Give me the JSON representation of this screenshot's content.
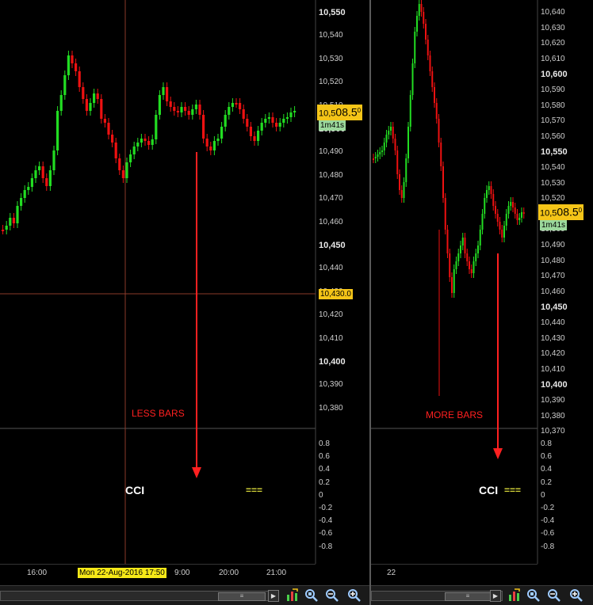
{
  "left_chart": {
    "price_ticks": [
      "10,550",
      "10,540",
      "10,530",
      "10,520",
      "10,510",
      "10,500",
      "10,490",
      "10,480",
      "10,470",
      "10,460",
      "10,450",
      "10,440",
      "10,430",
      "10,420",
      "10,410",
      "10,400",
      "10,390",
      "10,380"
    ],
    "bold_ticks": [
      "10,550",
      "10,500",
      "10,450",
      "10,400"
    ],
    "price_tag_prefix": "10,5",
    "price_tag_main": "08.5",
    "price_tag_sup": "0",
    "timer": "1m41s",
    "crosshair_price": "10,430.0",
    "annotation": "LESS BARS",
    "indicator_label": "CCI",
    "indicator_eq": "===",
    "cci_ticks": [
      "0.8",
      "0.6",
      "0.4",
      "0.2",
      "0",
      "-0.2",
      "-0.4",
      "-0.6",
      "-0.8"
    ],
    "time_labels": [
      "16:00",
      "9:00",
      "20:00",
      "21:00"
    ],
    "date_tag": "Mon 22-Aug-2016 17:50"
  },
  "right_chart": {
    "price_ticks": [
      "10,640",
      "10,630",
      "10,620",
      "10,610",
      "10,600",
      "10,590",
      "10,580",
      "10,570",
      "10,560",
      "10,550",
      "10,540",
      "10,530",
      "10,520",
      "10,510",
      "10,500",
      "10,490",
      "10,480",
      "10,470",
      "10,460",
      "10,450",
      "10,440",
      "10,430",
      "10,420",
      "10,410",
      "10,400",
      "10,390",
      "10,380",
      "10,370"
    ],
    "bold_ticks": [
      "10,600",
      "10,550",
      "10,450",
      "10,400"
    ],
    "price_tag_prefix": "10,5",
    "price_tag_main": "08.5",
    "price_tag_sup": "0",
    "timer": "1m41s",
    "annotation": "MORE BARS",
    "indicator_label": "CCI",
    "indicator_eq": "===",
    "cci_ticks": [
      "0.8",
      "0.6",
      "0.4",
      "0.2",
      "0",
      "-0.2",
      "-0.4",
      "-0.6",
      "-0.8"
    ],
    "time_labels": [
      "22"
    ]
  },
  "toolbar": {
    "scroll_thumb_glyph": "≡",
    "scroll_right_glyph": "▶",
    "icons": [
      "chart-settings-icon",
      "zoom-reset-icon",
      "zoom-out-icon",
      "zoom-in-icon"
    ]
  },
  "colors": {
    "up": "#22dd22",
    "down": "#ee1111",
    "annotation": "#ff2020",
    "price_tag": "#f5c518",
    "timer": "#9bd89b",
    "crosshair": "#8a3a2a"
  }
}
